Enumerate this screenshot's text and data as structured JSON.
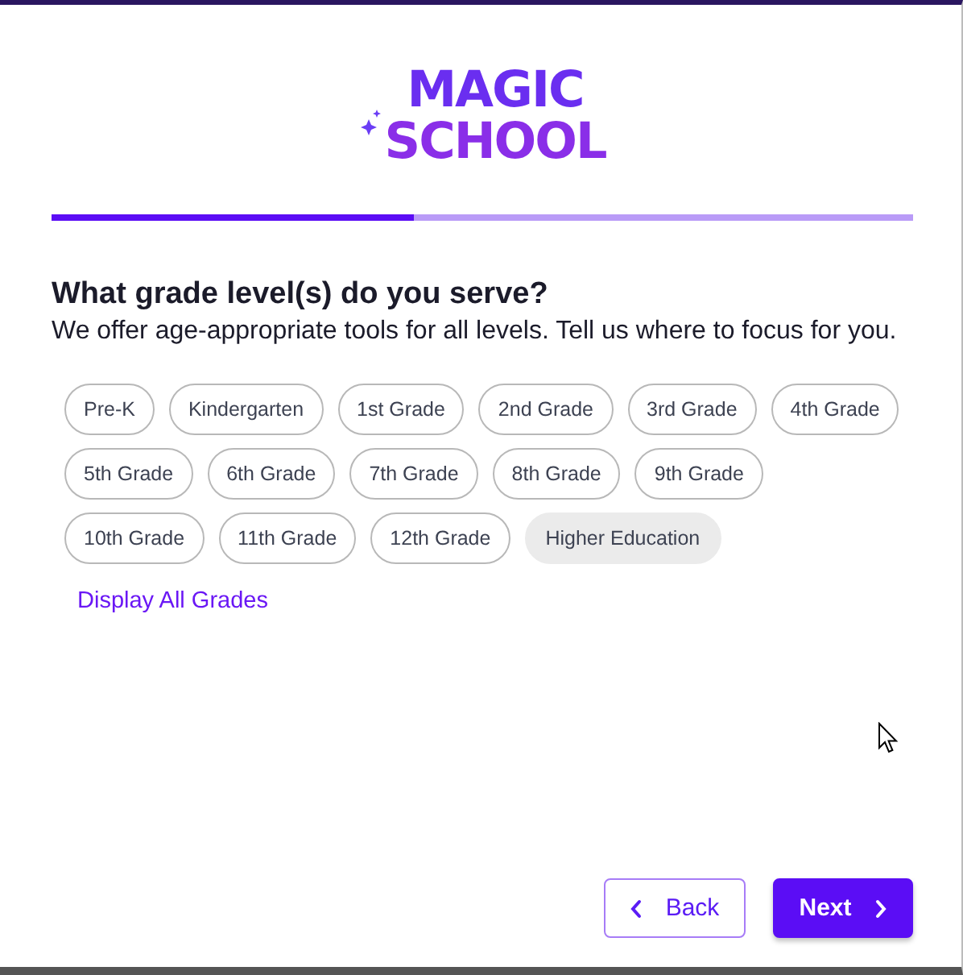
{
  "logo": {
    "line_1": "MAGIC",
    "line_2": "SCHOOL"
  },
  "progress": {
    "level": 0.42
  },
  "question": {
    "title": "What grade level(s) do you serve?",
    "subtitle": "We offer age-appropriate tools for all levels. Tell us where to focus for you."
  },
  "grades": [
    {
      "label": "Pre-K",
      "selected": false
    },
    {
      "label": "Kindergarten",
      "selected": false
    },
    {
      "label": "1st Grade",
      "selected": false
    },
    {
      "label": "2nd Grade",
      "selected": false
    },
    {
      "label": "3rd Grade",
      "selected": false
    },
    {
      "label": "4th Grade",
      "selected": false
    },
    {
      "label": "5th Grade",
      "selected": false
    },
    {
      "label": "6th Grade",
      "selected": false
    },
    {
      "label": "7th Grade",
      "selected": false
    },
    {
      "label": "8th Grade",
      "selected": false
    },
    {
      "label": "9th Grade",
      "selected": false
    },
    {
      "label": "10th Grade",
      "selected": false
    },
    {
      "label": "11th Grade",
      "selected": false
    },
    {
      "label": "12th Grade",
      "selected": false
    },
    {
      "label": "Higher Education",
      "selected": true
    }
  ],
  "display_all_link": "Display All Grades",
  "buttons": {
    "back": "Back",
    "next": "Next"
  }
}
